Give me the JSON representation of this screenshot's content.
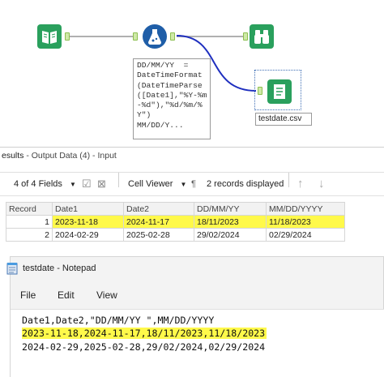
{
  "workflow": {
    "formula_note": "DD/MM/YY  =\nDateTimeFormat\n(DateTimeParse\n([Date1],\"%Y-%m\n-%d\"),\"%d/%m/%\nY\")\nMM/DD/Y...",
    "output_label": "testdate.csv",
    "tools": [
      {
        "name": "input-data-tool",
        "icon": "book-icon",
        "color": "#2aa05d"
      },
      {
        "name": "formula-tool",
        "icon": "flask-icon",
        "color": "#1f5ea8"
      },
      {
        "name": "browse-tool",
        "icon": "binoculars-icon",
        "color": "#2aa05d"
      },
      {
        "name": "output-data-tool",
        "icon": "document-icon",
        "color": "#2aa05d"
      }
    ]
  },
  "results": {
    "title_prefix": "esults",
    "title_rest": " - Output Data (4) - Input",
    "fields_dropdown": "4 of 4 Fields",
    "viewer_dropdown": "Cell Viewer",
    "records_status": "2 records displayed"
  },
  "grid": {
    "columns": [
      "Record",
      "Date1",
      "Date2",
      "DD/MM/YY",
      "MM/DD/YYYY"
    ],
    "rows": [
      [
        "1",
        "2023-11-18",
        "2024-11-17",
        "18/11/2023",
        "11/18/2023"
      ],
      [
        "2",
        "2024-02-29",
        "2025-02-28",
        "29/02/2024",
        "02/29/2024"
      ]
    ],
    "highlight_color": "#fff94a"
  },
  "notepad": {
    "title": "testdate - Notepad",
    "menu": [
      "File",
      "Edit",
      "View"
    ],
    "lines": [
      "Date1,Date2,\"DD/MM/YY \",MM/DD/YYYY",
      "2023-11-18,2024-11-17,18/11/2023,11/18/2023",
      "2024-02-29,2025-02-28,29/02/2024,02/29/2024"
    ]
  }
}
